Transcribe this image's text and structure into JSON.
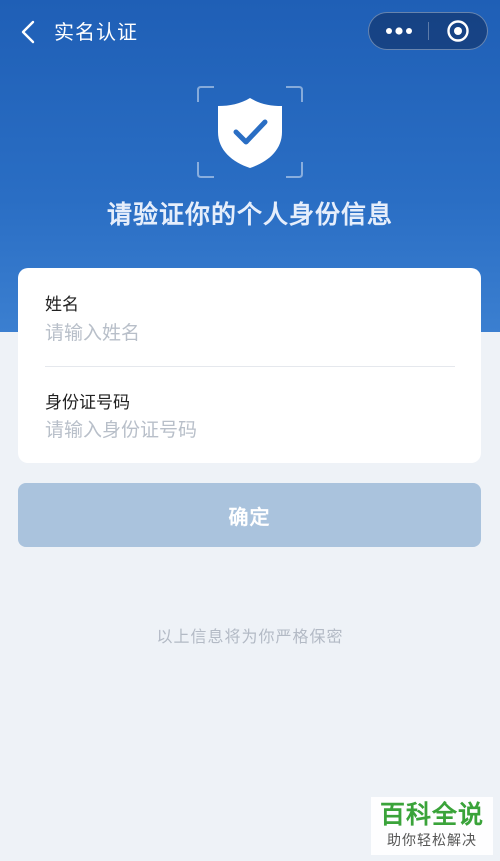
{
  "nav": {
    "title": "实名认证",
    "back_icon": "chevron-left-icon",
    "more_icon": "more-dots-icon",
    "close_icon": "target-close-icon"
  },
  "hero": {
    "headline": "请验证你的个人身份信息",
    "shield_icon": "shield-check-icon"
  },
  "form": {
    "name_label": "姓名",
    "name_placeholder": "请输入姓名",
    "name_value": "",
    "id_label": "身份证号码",
    "id_placeholder": "请输入身份证号码",
    "id_value": ""
  },
  "confirm_label": "确定",
  "privacy_note": "以上信息将为你严格保密",
  "watermark": {
    "title": "百科全说",
    "subtitle": "助你轻松解决"
  },
  "colors": {
    "header_blue": "#2a6ec4",
    "button_disabled": "#aac3dd",
    "page_bg": "#eef2f7"
  }
}
